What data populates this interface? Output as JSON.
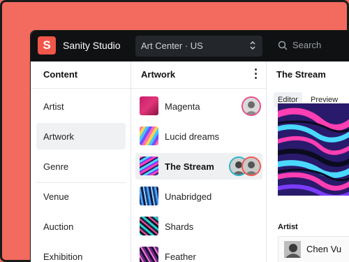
{
  "topbar": {
    "logo_letter": "S",
    "title": "Sanity Studio",
    "dataset": "Art Center · US",
    "search_placeholder": "Search"
  },
  "content_pane": {
    "title": "Content",
    "items": [
      {
        "label": "Artist"
      },
      {
        "label": "Artwork"
      },
      {
        "label": "Genre"
      },
      {
        "label": "Venue"
      },
      {
        "label": "Auction"
      },
      {
        "label": "Exhibition"
      }
    ],
    "selected": "Artwork"
  },
  "artwork_pane": {
    "title": "Artwork",
    "items": [
      {
        "label": "Magenta"
      },
      {
        "label": "Lucid dreams"
      },
      {
        "label": "The Stream"
      },
      {
        "label": "Unabridged"
      },
      {
        "label": "Shards"
      },
      {
        "label": "Feather"
      }
    ],
    "selected": "The Stream"
  },
  "document_pane": {
    "title": "The Stream",
    "tabs": [
      {
        "label": "Editor"
      },
      {
        "label": "Preview"
      }
    ],
    "active_tab": "Editor",
    "field_label": "Artist",
    "artist_ref": "Chen Vu"
  },
  "colors": {
    "background": "#f36a5f",
    "brand": "#f2554a",
    "topbar": "#101112",
    "presence_ring": "#e84d8a"
  }
}
